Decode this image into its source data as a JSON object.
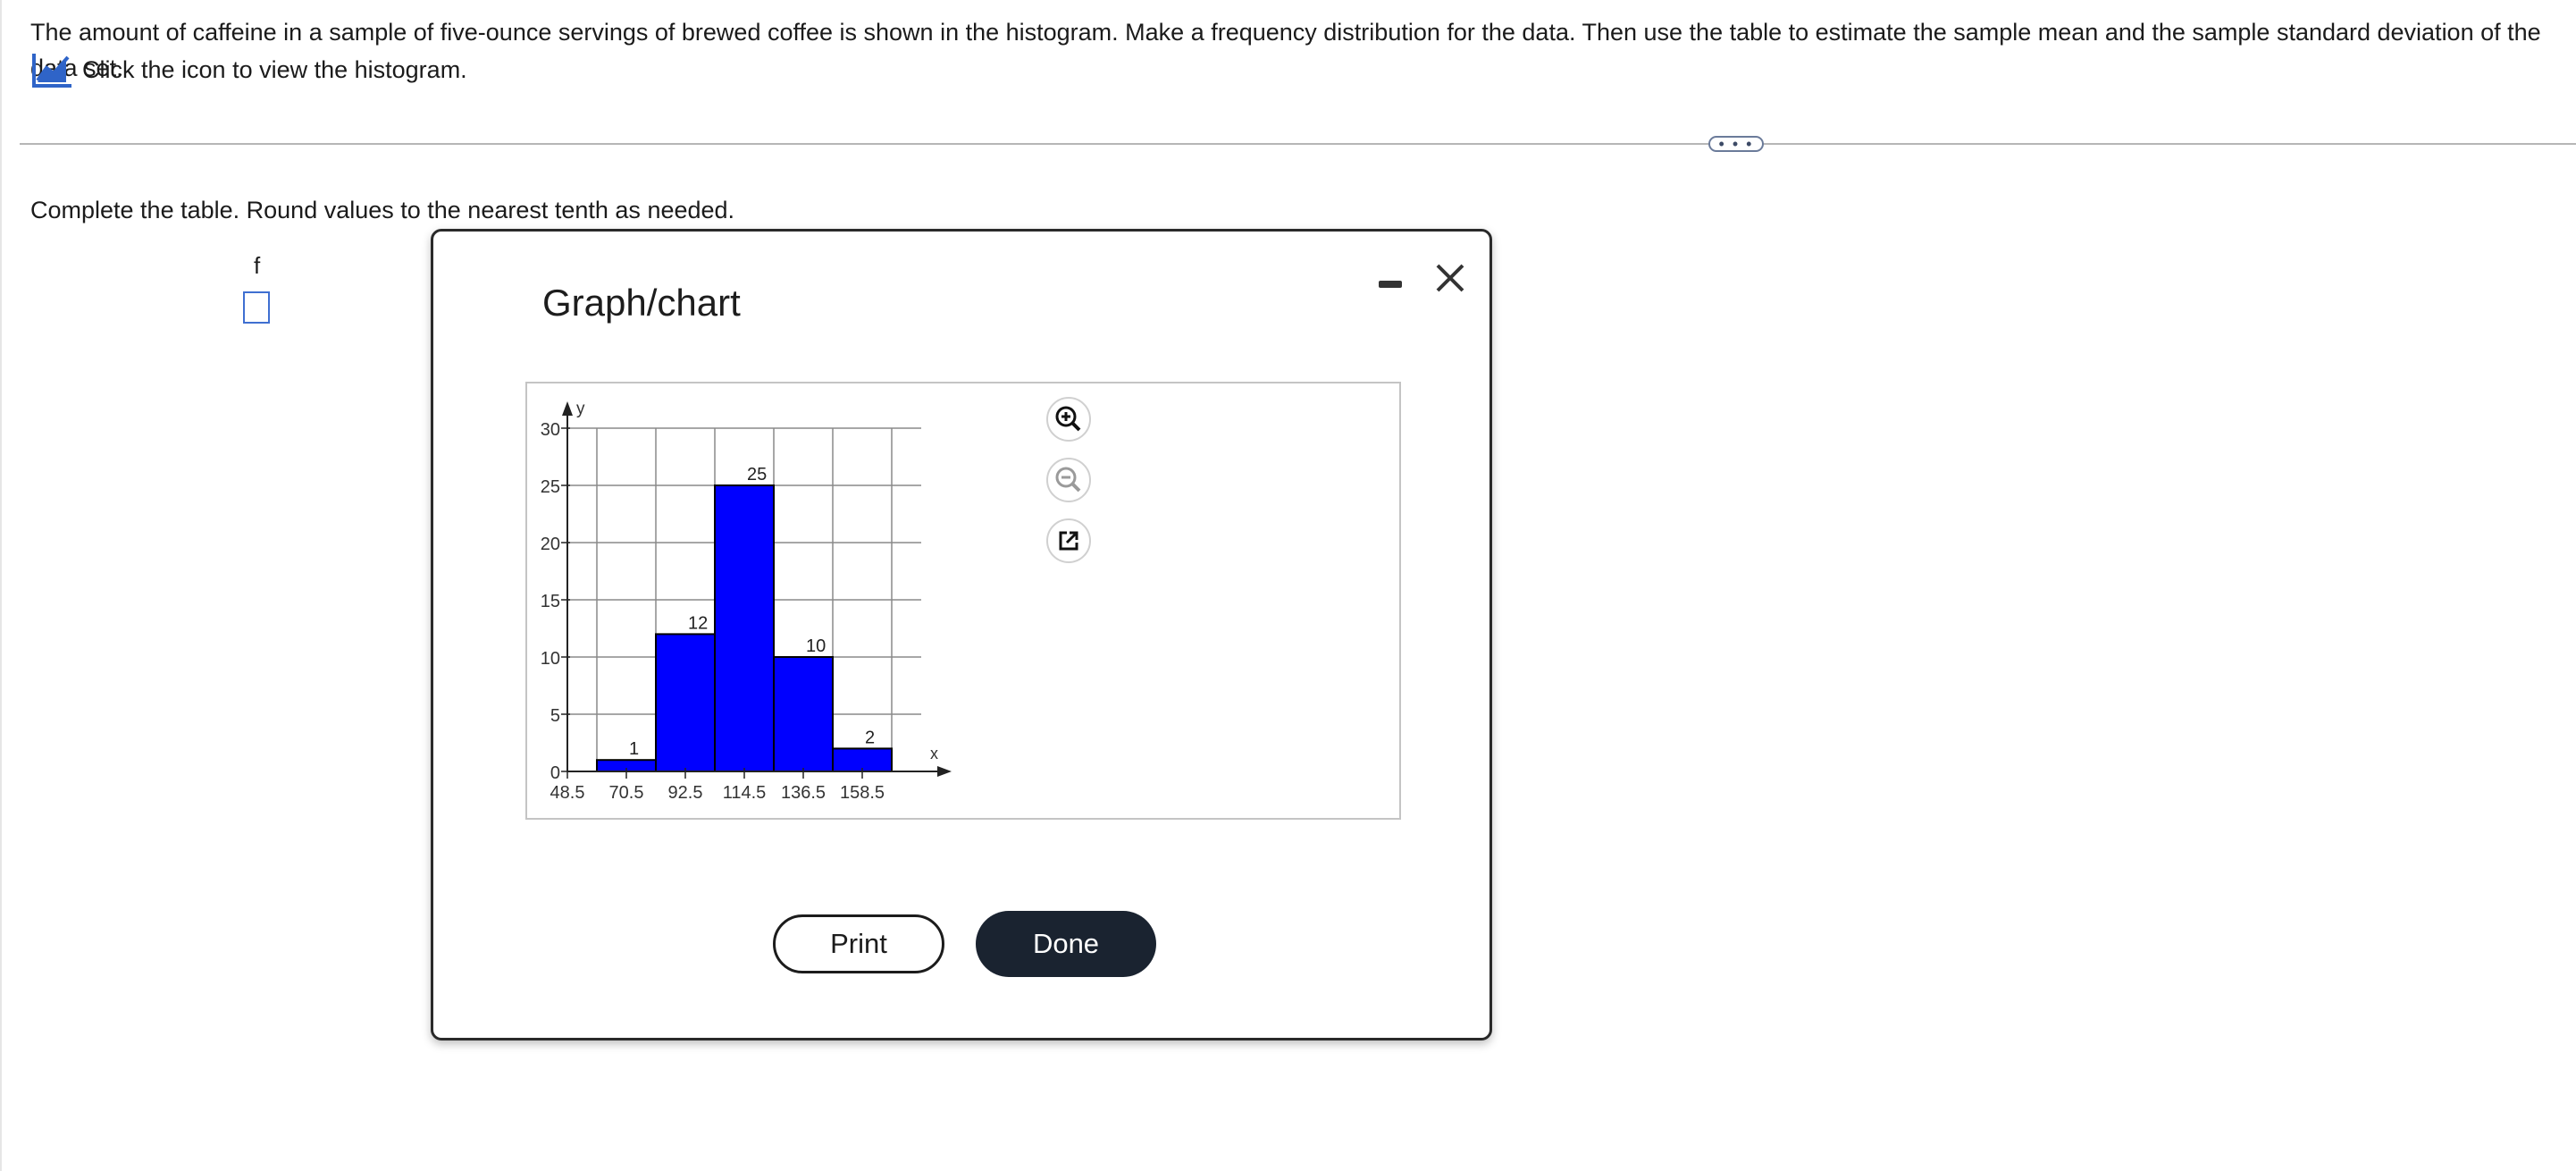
{
  "question": {
    "text": "The amount of caffeine in a sample of five-ounce servings of brewed coffee is shown in the histogram. Make a frequency distribution for the data. Then use the table to estimate the sample mean and the sample standard deviation of the data set.",
    "hint": "Click the icon to view the histogram.",
    "icon": "line-chart-icon"
  },
  "more_button": {
    "label": "• • •"
  },
  "answer": {
    "instruction": "Complete the table. Round values to the nearest tenth as needed.",
    "column_header": "f",
    "input_value": ""
  },
  "dialog": {
    "title": "Graph/chart",
    "minimize_icon": "minus-icon",
    "close_icon": "close-x-icon",
    "tools": [
      "zoom-in-icon",
      "zoom-out-icon",
      "external-link-icon"
    ],
    "print_label": "Print",
    "done_label": "Done"
  },
  "colors": {
    "bar_fill": "#0000ff",
    "done_bg": "#1a2330",
    "input_border": "#3f6fd1"
  },
  "chart_data": {
    "type": "bar",
    "histogram": true,
    "xlabel": "x",
    "ylabel": "y",
    "x_ticks": [
      "48.5",
      "70.5",
      "92.5",
      "114.5",
      "136.5",
      "158.5"
    ],
    "y_ticks": [
      0,
      5,
      10,
      15,
      20,
      25,
      30
    ],
    "ylim": [
      0,
      30
    ],
    "xlim": [
      48.5,
      180.5
    ],
    "grid": true,
    "bins": [
      {
        "start": 59.5,
        "end": 81.5,
        "value": 1
      },
      {
        "start": 81.5,
        "end": 103.5,
        "value": 12
      },
      {
        "start": 103.5,
        "end": 125.5,
        "value": 25
      },
      {
        "start": 125.5,
        "end": 147.5,
        "value": 10
      },
      {
        "start": 147.5,
        "end": 169.5,
        "value": 2
      }
    ]
  }
}
